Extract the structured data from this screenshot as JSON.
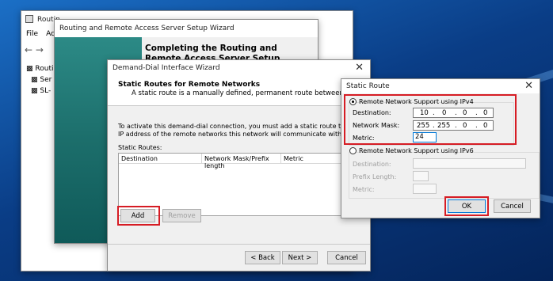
{
  "mmc": {
    "title": "Routin",
    "menu": [
      "File",
      "Act"
    ],
    "tree": [
      "Routin",
      "Ser",
      "SL-"
    ]
  },
  "setup_wizard": {
    "title": "Routing and Remote Access Server Setup Wizard",
    "heading": "Completing the Routing and Remote Access Server Setup Wizard"
  },
  "demand_dial": {
    "title": "Demand-Dial Interface Wizard",
    "header_title": "Static Routes for Remote Networks",
    "header_subtitle": "A static route is a manually defined, permanent route between two networks.",
    "body_line1": "To activate this demand-dial connection, you must add a static route to the network. Spe",
    "body_line2": "IP address of the remote networks this network will communicate with.",
    "static_routes_label": "Static Routes:",
    "columns": [
      "Destination",
      "Network Mask/Prefix length",
      "Metric"
    ],
    "add_label": "Add",
    "remove_label": "Remove",
    "back_label": "< Back",
    "next_label": "Next >",
    "cancel_label": "Cancel"
  },
  "static_route": {
    "title": "Static Route",
    "ipv4_label": "Remote Network Support using IPv4",
    "destination_label": "Destination:",
    "destination": [
      "10",
      "0",
      "0",
      "0"
    ],
    "mask_label": "Network Mask:",
    "mask": [
      "255",
      "255",
      "0",
      "0"
    ],
    "metric_label": "Metric:",
    "metric": "24",
    "ipv6_label": "Remote Network Support using IPv6",
    "v6_destination_label": "Destination:",
    "v6_prefix_label": "Prefix Length:",
    "v6_metric_label": "Metric:",
    "ok_label": "OK",
    "cancel_label": "Cancel"
  },
  "colors": {
    "highlight": "#d61c24",
    "accent": "#0078d7",
    "wizard_banner": "#1c6e6b"
  }
}
